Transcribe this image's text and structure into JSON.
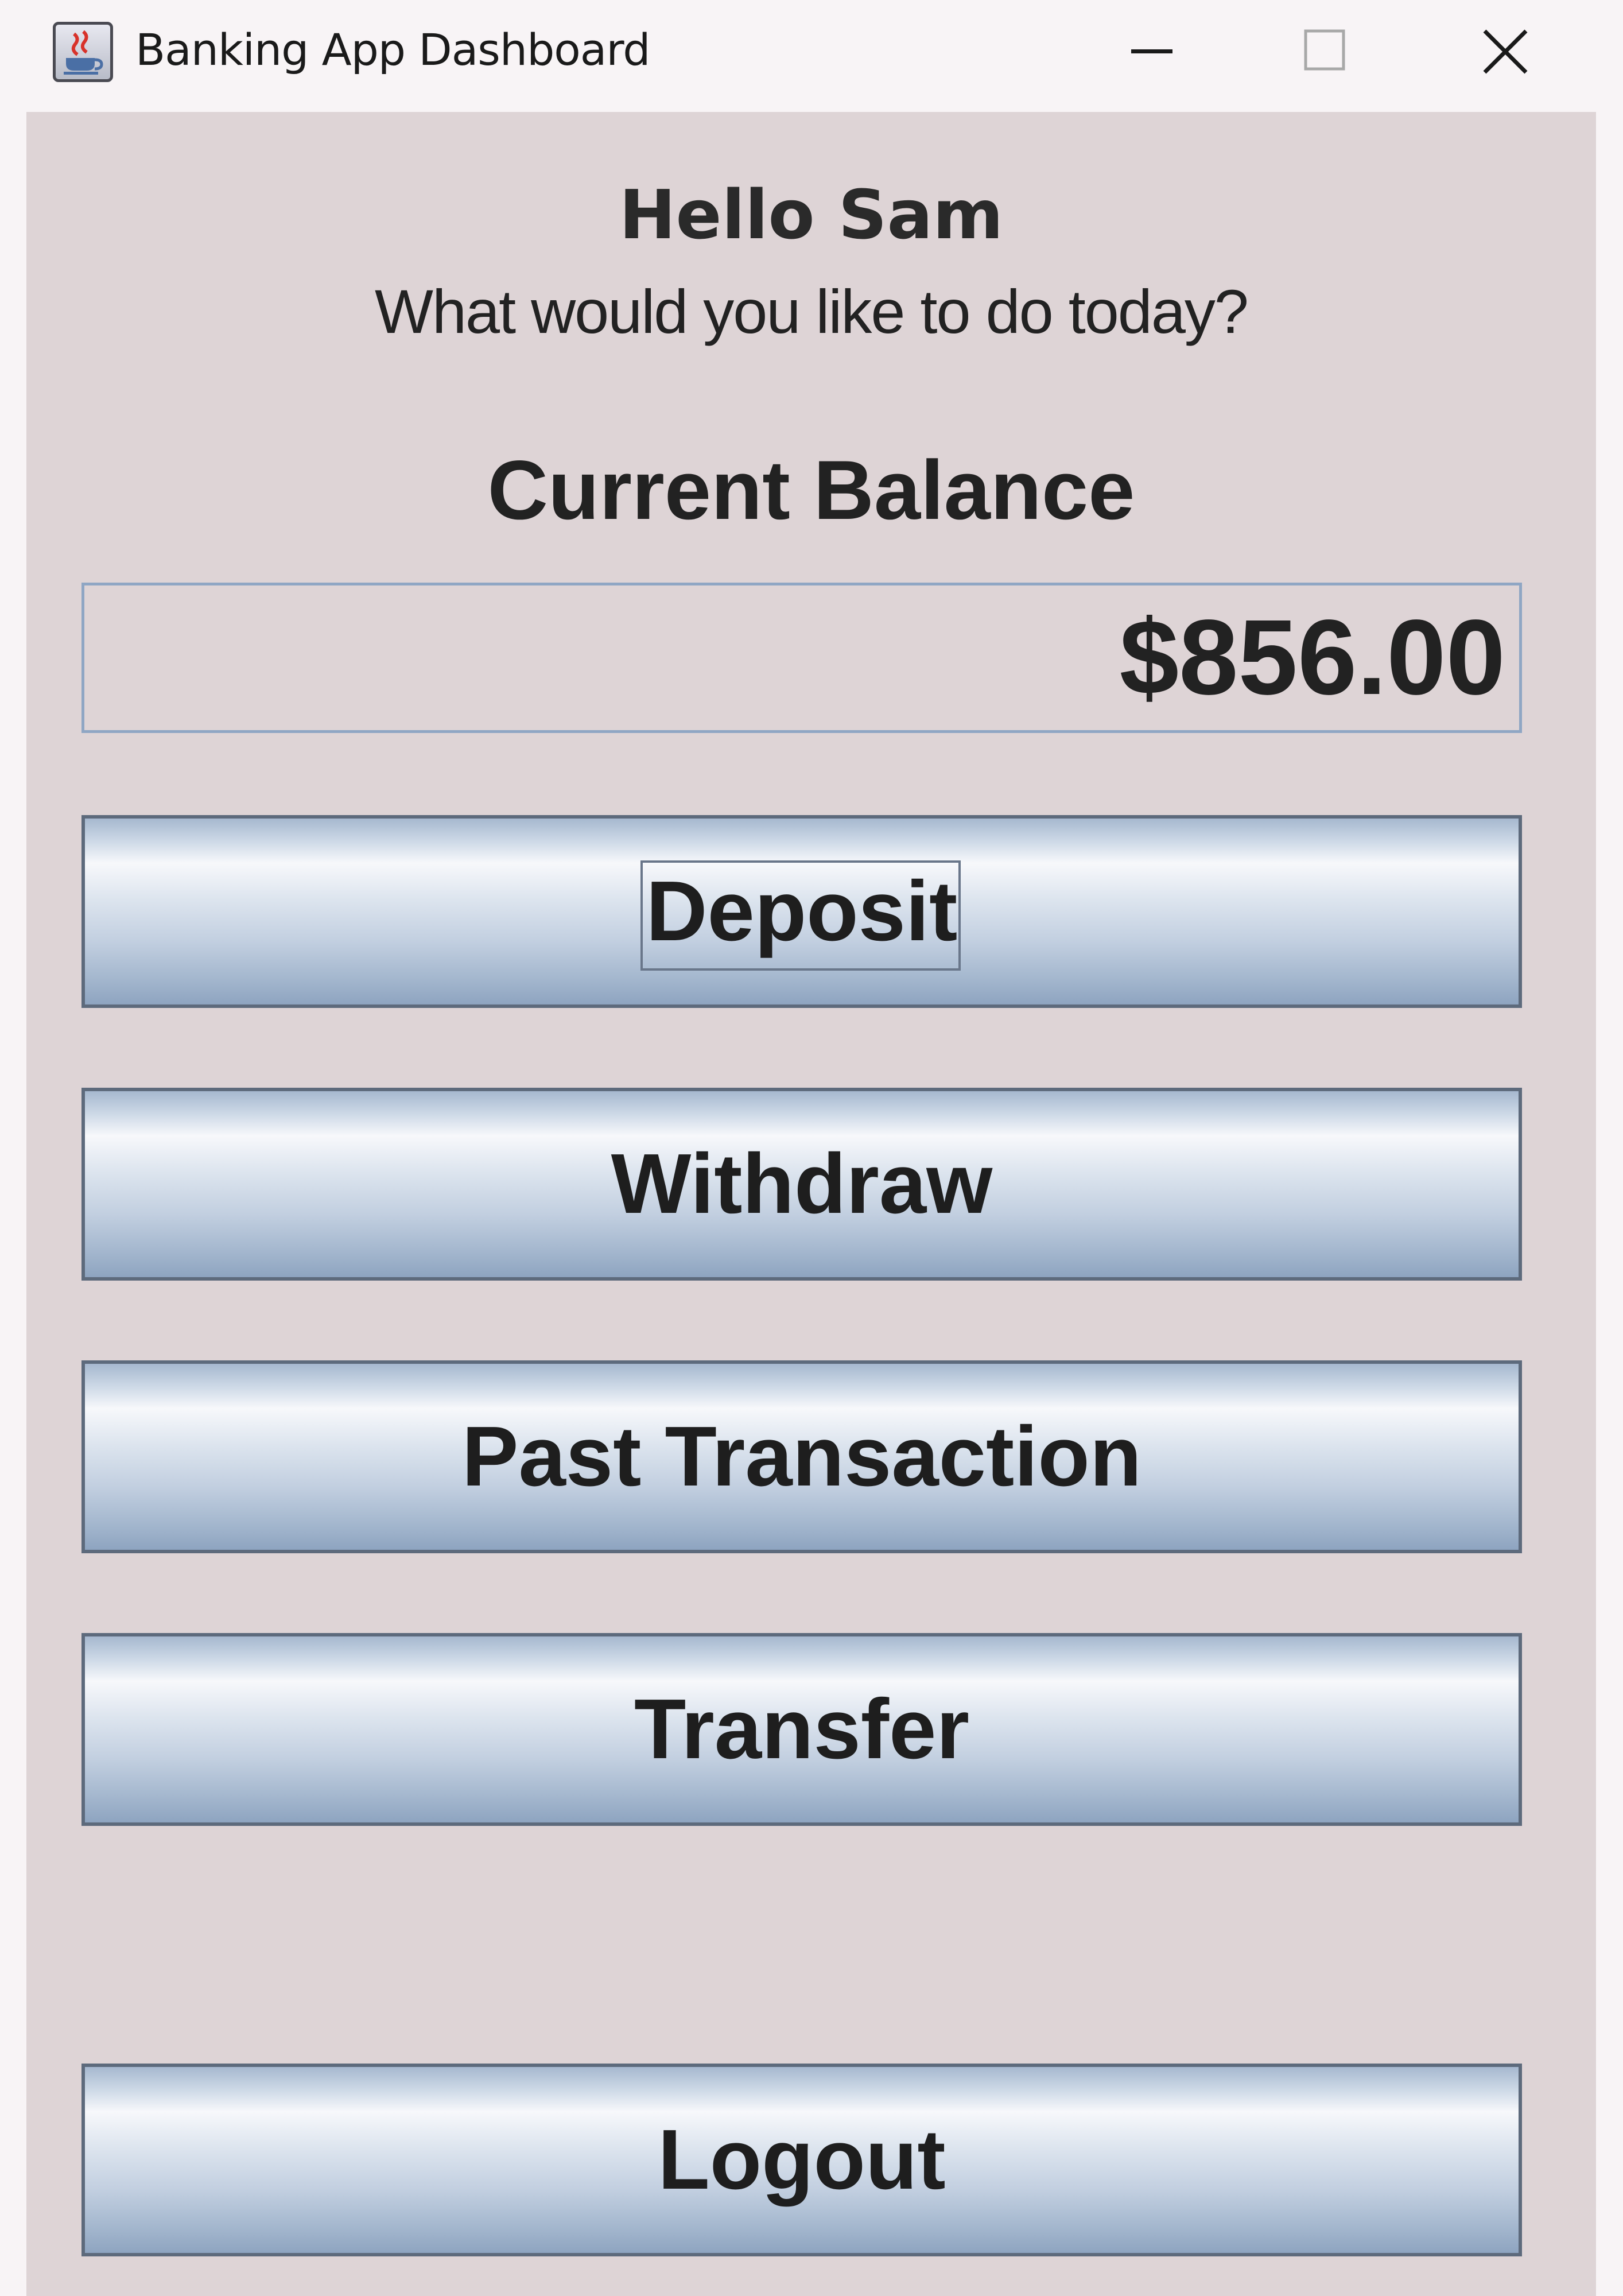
{
  "window": {
    "title": "Banking App Dashboard"
  },
  "header": {
    "greeting": "Hello Sam",
    "subtitle": "What would you like to do today?"
  },
  "balance": {
    "label": "Current Balance",
    "value": "$856.00"
  },
  "actions": {
    "deposit_label": "Deposit",
    "withdraw_label": "Withdraw",
    "past_transaction_label": "Past Transaction",
    "transfer_label": "Transfer",
    "logout_label": "Logout"
  },
  "icons": {
    "app": "java-coffee-cup-icon",
    "minimize": "minimize-icon",
    "maximize": "maximize-icon",
    "close": "close-icon"
  },
  "colors": {
    "panel_background": "#ded4d6",
    "titlebar_background": "#f8f4f6",
    "button_border": "#5d6a7c",
    "field_border": "#8fa6c4"
  }
}
